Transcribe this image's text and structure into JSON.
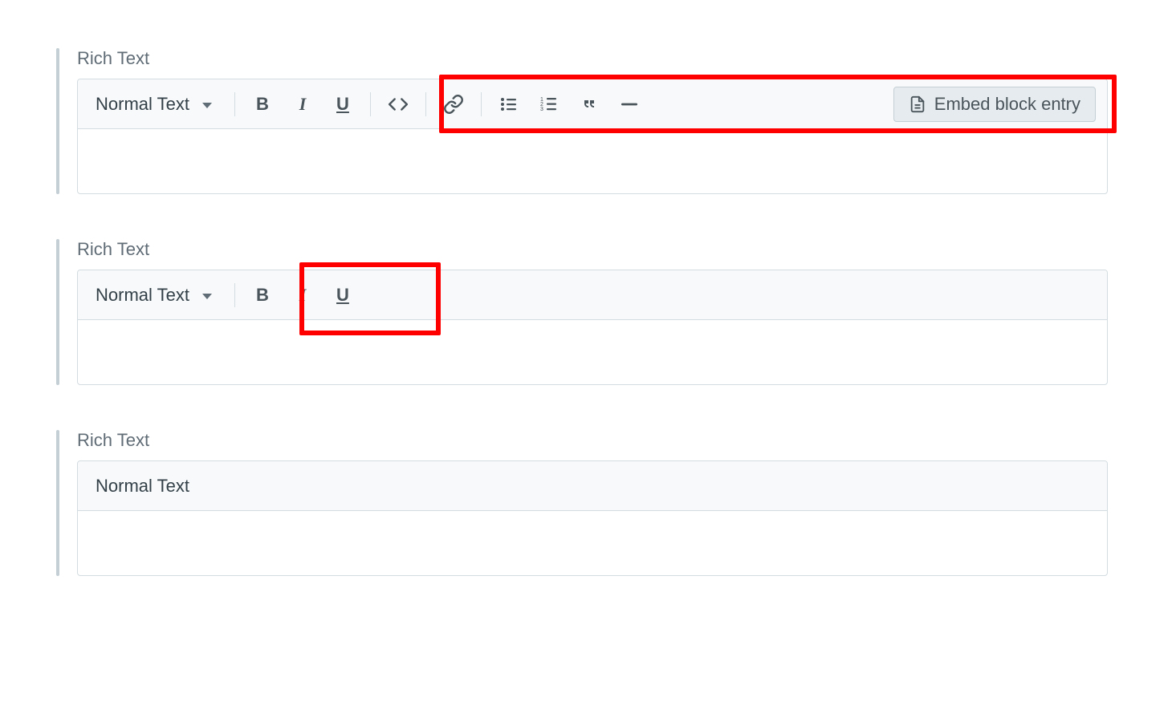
{
  "fields": [
    {
      "label": "Rich Text",
      "dropdown": "Normal Text",
      "embed_label": "Embed block entry"
    },
    {
      "label": "Rich Text",
      "dropdown": "Normal Text"
    },
    {
      "label": "Rich Text",
      "dropdown": "Normal Text"
    }
  ],
  "icons": {
    "bold": "bold-icon",
    "italic": "italic-icon",
    "underline": "underline-icon",
    "code": "code-icon",
    "link": "link-icon",
    "ul": "bulleted-list-icon",
    "ol": "numbered-list-icon",
    "quote": "blockquote-icon",
    "hr": "horizontal-rule-icon",
    "doc": "document-icon"
  }
}
